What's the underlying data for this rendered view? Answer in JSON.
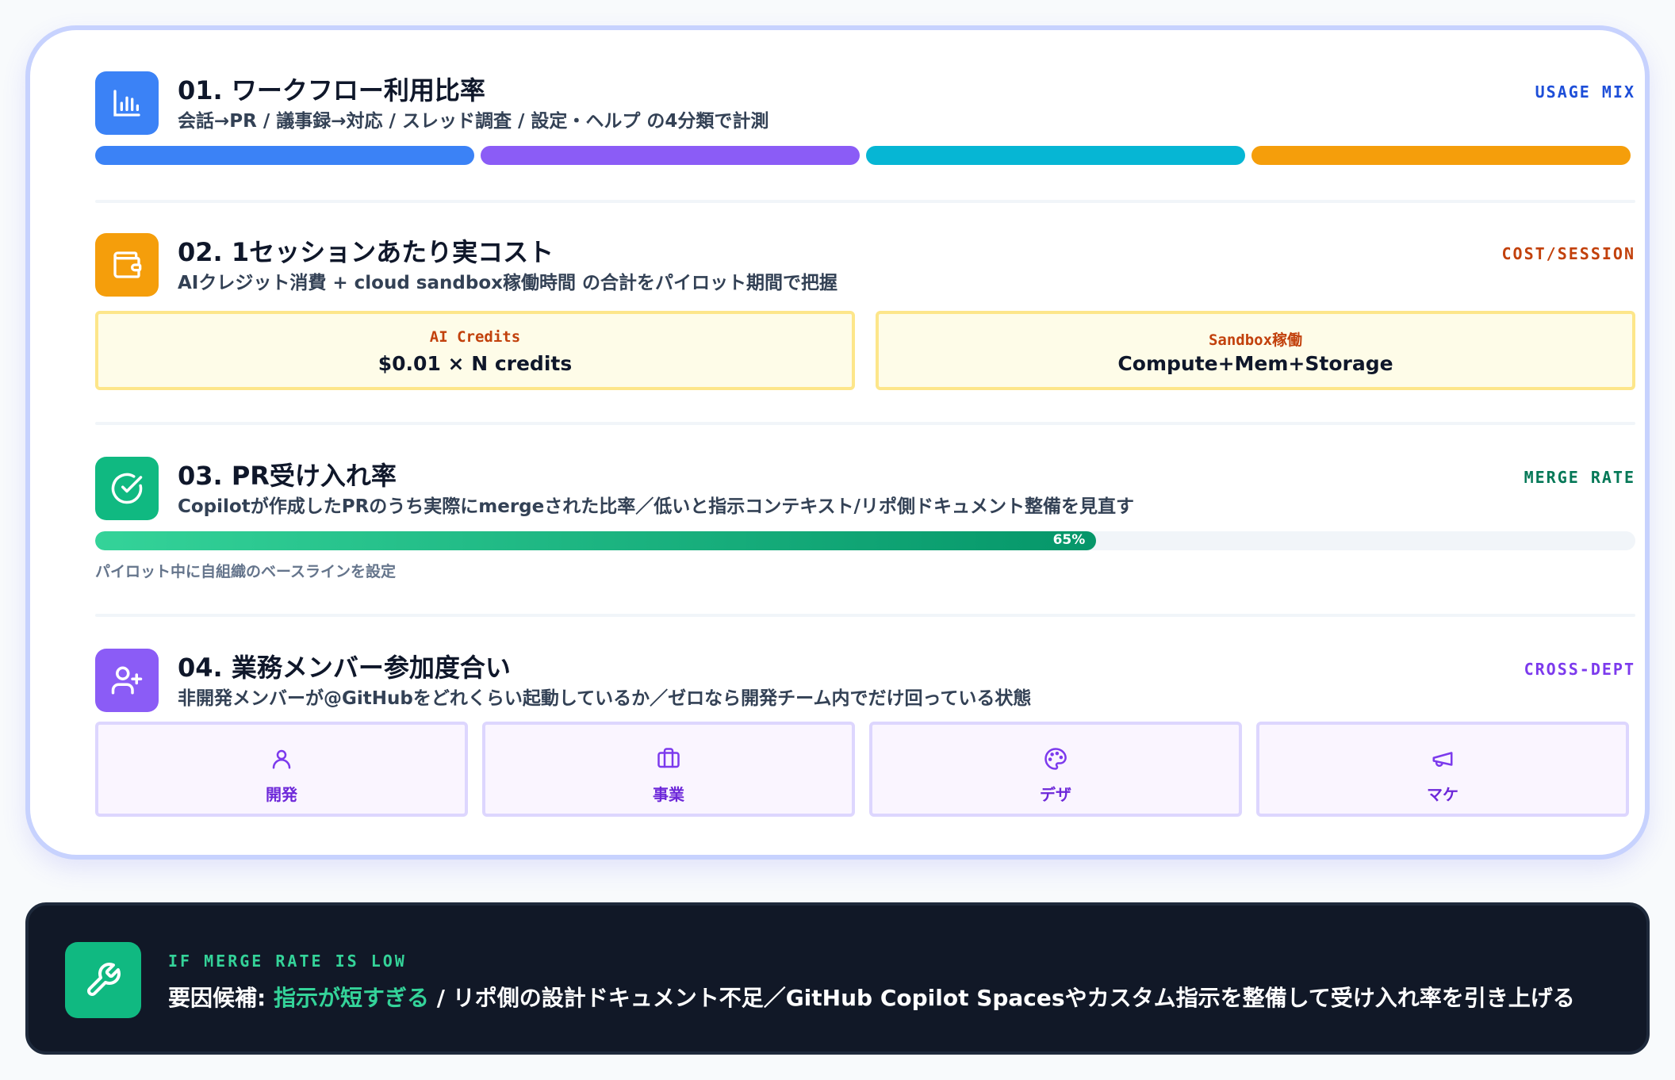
{
  "colors": {
    "blue": "#3b82f6",
    "purple": "#8b5cf6",
    "cyan": "#06b6d4",
    "amber": "#f59e0b",
    "green": "#10b981",
    "violet": "#7c3aed",
    "card_border": "#c7d2fe",
    "tip_bg": "#111827"
  },
  "sections": [
    {
      "title": "01. ワークフロー利用比率",
      "subtitle": "会話→PR / 議事録→対応 / スレッド調査 / 設定・ヘルプ の4分類で計測",
      "tag": "USAGE MIX",
      "icon": "bar-chart-icon"
    },
    {
      "title": "02. 1セッションあたり実コスト",
      "subtitle": "AIクレジット消費 + cloud sandbox稼働時間 の合計をパイロット期間で把握",
      "tag": "COST/SESSION",
      "icon": "wallet-icon",
      "cost_items": [
        {
          "label": "AI Credits",
          "value": "$0.01 × N credits"
        },
        {
          "label": "Sandbox稼働",
          "value": "Compute+Mem+Storage"
        }
      ]
    },
    {
      "title": "03. PR受け入れ率",
      "subtitle": "Copilotが作成したPRのうち実際にmergeされた比率／低いと指示コンテキスト/リポ側ドキュメント整備を見直す",
      "tag": "MERGE RATE",
      "icon": "check-circle-icon",
      "progress": {
        "value": 0.65,
        "label": "65%"
      },
      "note": "パイロット中に自組織のベースラインを設定"
    },
    {
      "title": "04. 業務メンバー参加度合い",
      "subtitle": "非開発メンバーが@GitHubをどれくらい起動しているか／ゼロなら開発チーム内でだけ回っている状態",
      "tag": "CROSS-DEPT",
      "icon": "user-plus-icon",
      "departments": [
        {
          "label": "開発",
          "icon": "user-icon"
        },
        {
          "label": "事業",
          "icon": "briefcase-icon"
        },
        {
          "label": "デザ",
          "icon": "palette-icon"
        },
        {
          "label": "マケ",
          "icon": "megaphone-icon"
        }
      ]
    }
  ],
  "tip": {
    "eyebrow": "IF MERGE RATE IS LOW",
    "prefix": "要因候補: ",
    "highlight": "指示が短すぎる",
    "rest": " / リポ側の設計ドキュメント不足／GitHub Copilot Spacesやカスタム指示を整備して受け入れ率を引き上げる",
    "icon": "wrench-icon"
  }
}
